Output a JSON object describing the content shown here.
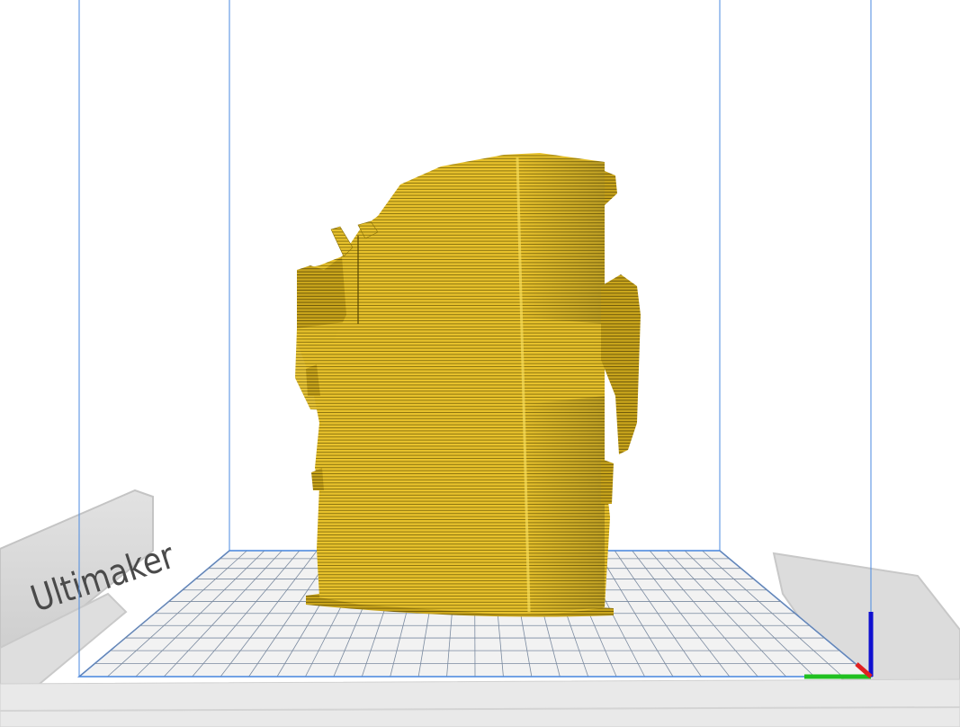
{
  "app": {
    "brand_logo_text": "Ultimaker"
  },
  "viewport": {
    "background": "#ffffff",
    "model_color": "#e8c22c",
    "model_layer_line_color": "#6e5a05",
    "build_volume_line_color": "#4a90e2",
    "plate_grid_color": "#6f7f96",
    "plate_color": "#f0f0f0",
    "printer_frame_color": "#d8d8d8"
  },
  "axes_indicator": {
    "x_color": "#e02020",
    "y_color": "#20c020",
    "z_color": "#1010d0"
  }
}
